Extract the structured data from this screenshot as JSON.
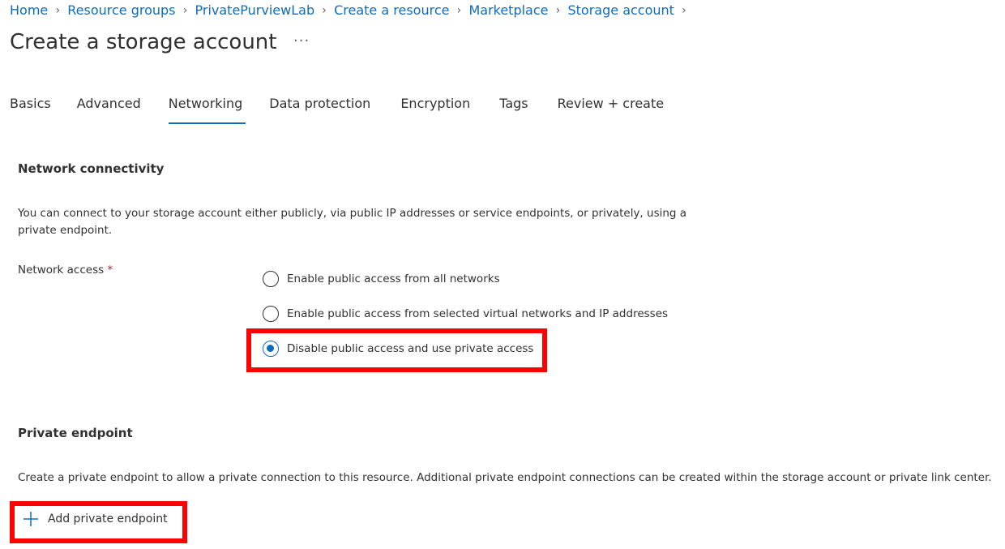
{
  "breadcrumb": [
    {
      "label": "Home"
    },
    {
      "label": "Resource groups"
    },
    {
      "label": "PrivatePurviewLab"
    },
    {
      "label": "Create a resource"
    },
    {
      "label": "Marketplace"
    },
    {
      "label": "Storage account"
    }
  ],
  "page": {
    "title": "Create a storage account",
    "more_label": "···"
  },
  "tabs": [
    {
      "label": "Basics",
      "active": false
    },
    {
      "label": "Advanced",
      "active": false
    },
    {
      "label": "Networking",
      "active": true
    },
    {
      "label": "Data protection",
      "active": false
    },
    {
      "label": "Encryption",
      "active": false
    },
    {
      "label": "Tags",
      "active": false
    },
    {
      "label": "Review + create",
      "active": false
    }
  ],
  "network_connectivity": {
    "heading": "Network connectivity",
    "description": "You can connect to your storage account either publicly, via public IP addresses or service endpoints, or privately, using a private endpoint.",
    "field_label": "Network access",
    "required_marker": "*",
    "options": [
      {
        "label": "Enable public access from all networks",
        "selected": false
      },
      {
        "label": "Enable public access from selected virtual networks and IP addresses",
        "selected": false
      },
      {
        "label": "Disable public access and use private access",
        "selected": true
      }
    ]
  },
  "private_endpoint": {
    "heading": "Private endpoint",
    "description": "Create a private endpoint to allow a private connection to this resource. Additional private endpoint connections can be created within the storage account or private link center.",
    "add_button_label": "Add private endpoint"
  },
  "colors": {
    "accent": "#0f6cbd",
    "highlight": "#ff0000",
    "text": "#323130"
  }
}
